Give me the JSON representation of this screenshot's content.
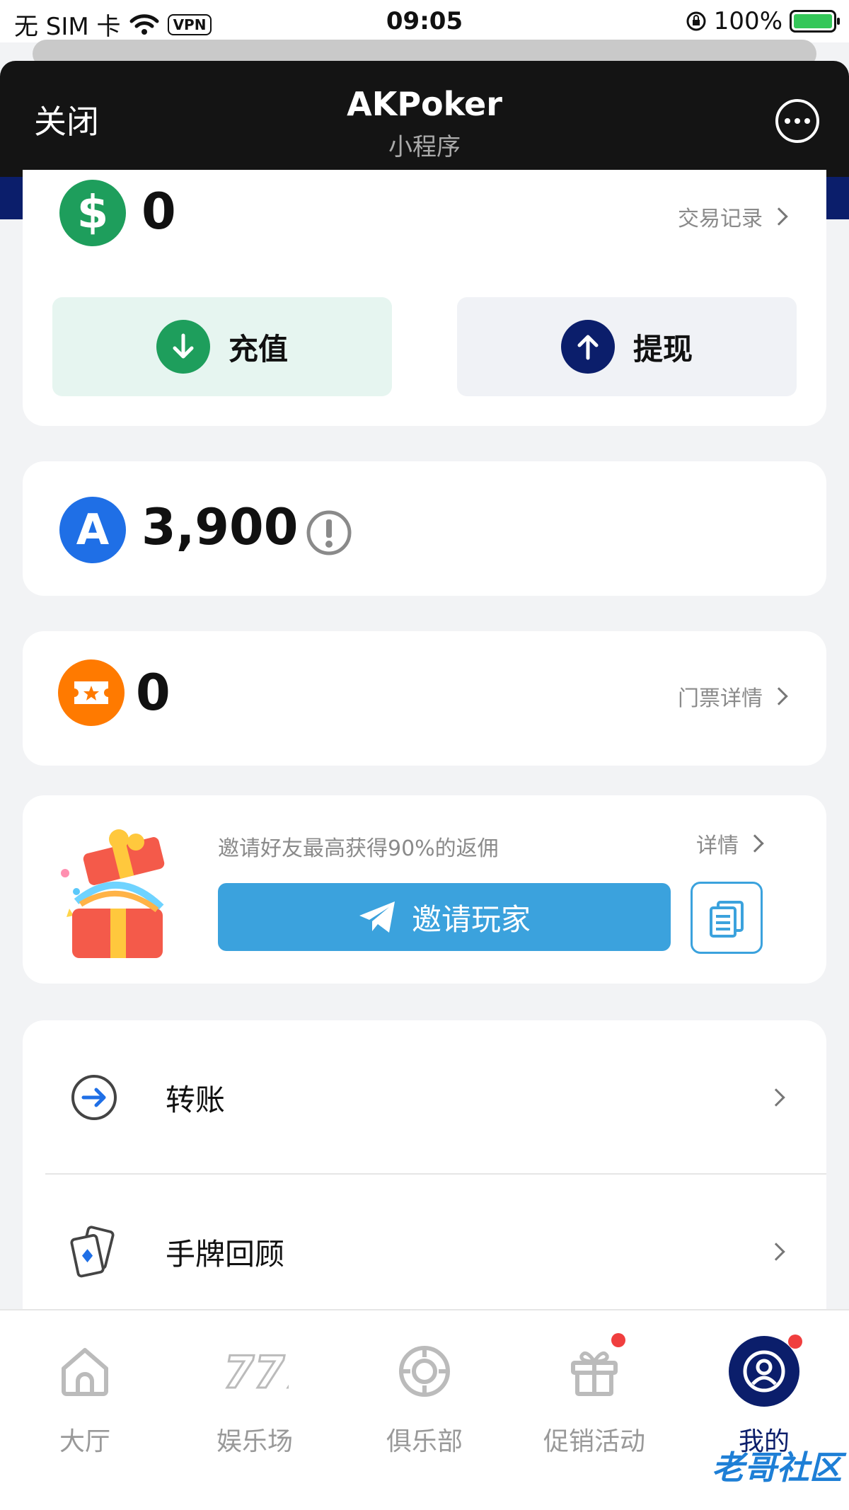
{
  "status_bar": {
    "carrier": "无 SIM 卡",
    "vpn": "VPN",
    "time": "09:05",
    "battery": "100%"
  },
  "header": {
    "close": "关闭",
    "title": "AKPoker",
    "subtitle": "小程序"
  },
  "wallet": {
    "balance": "0",
    "history_link": "交易记录",
    "deposit_label": "充值",
    "withdraw_label": "提现"
  },
  "points": {
    "value": "3,900",
    "icon_letter": "A"
  },
  "tickets": {
    "value": "0",
    "detail_link": "门票详情"
  },
  "invite": {
    "text": "邀请好友最高获得90%的返佣",
    "detail_link": "详情",
    "button_label": "邀请玩家"
  },
  "menu": [
    {
      "label": "转账",
      "icon": "transfer-icon"
    },
    {
      "label": "手牌回顾",
      "icon": "cards-icon"
    }
  ],
  "tabs": [
    {
      "label": "大厅",
      "icon": "home-icon"
    },
    {
      "label": "娱乐场",
      "icon": "slots-777-icon"
    },
    {
      "label": "俱乐部",
      "icon": "chip-icon"
    },
    {
      "label": "促销活动",
      "icon": "gift-icon"
    },
    {
      "label": "我的",
      "icon": "profile-icon"
    }
  ],
  "watermark": "老哥社区",
  "colors": {
    "navy": "#0b1e6b",
    "green": "#1e9e5c",
    "blue": "#3ba2dd",
    "orange": "#ff7a00"
  }
}
